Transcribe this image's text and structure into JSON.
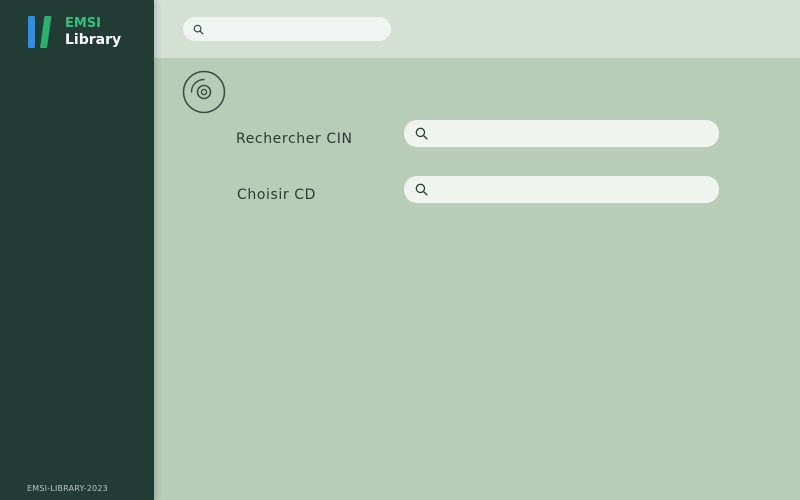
{
  "sidebar": {
    "logo": {
      "line1": "EMSI",
      "line2": "Library",
      "colors": {
        "bar_blue": "#2d8fe6",
        "bar_green": "#27b36b",
        "line1": "#32c27a",
        "line2": "#ffffff"
      }
    },
    "footer": "EMSI-LIBRARY-2023"
  },
  "topbar": {
    "search": {
      "placeholder": "",
      "value": "",
      "icon": "search-icon"
    }
  },
  "main": {
    "header_icon": "disc-icon",
    "fields": [
      {
        "label": "Rechercher CIN",
        "placeholder": "",
        "value": "",
        "icon": "search-icon"
      },
      {
        "label": "Choisir CD",
        "placeholder": "",
        "value": "",
        "icon": "search-icon"
      }
    ]
  },
  "theme": {
    "sidebar_bg": "#223b35",
    "topbar_bg": "#d4e0d4",
    "main_bg": "#b8cdb8",
    "field_bg": "#eff4ef"
  }
}
